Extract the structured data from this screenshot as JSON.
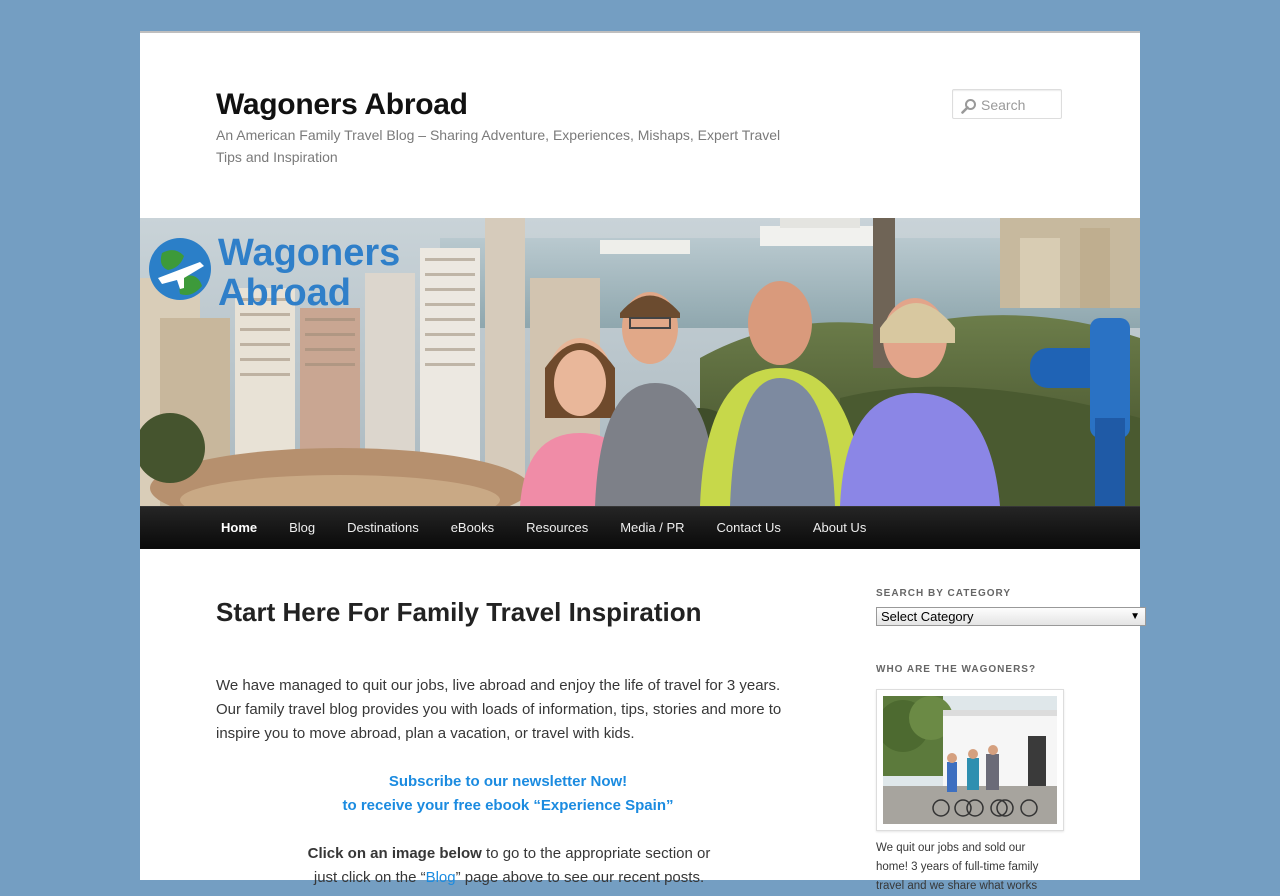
{
  "site": {
    "title": "Wagoners Abroad",
    "description": "An American Family Travel Blog – Sharing Adventure, Experiences, Mishaps, Expert Travel Tips and Inspiration"
  },
  "search": {
    "placeholder": "Search",
    "icon": "search-icon"
  },
  "banner": {
    "logo_line1": "Wagoners",
    "logo_line2": "Abroad",
    "logo_icon": "globe-airplane-icon"
  },
  "nav": {
    "items": [
      {
        "label": "Home",
        "current": true
      },
      {
        "label": "Blog"
      },
      {
        "label": "Destinations"
      },
      {
        "label": "eBooks"
      },
      {
        "label": "Resources"
      },
      {
        "label": "Media / PR"
      },
      {
        "label": "Contact Us"
      },
      {
        "label": "About Us"
      }
    ]
  },
  "main": {
    "title": "Start Here For Family Travel Inspiration",
    "intro": "We have managed to quit our jobs, live abroad and enjoy the life of travel for 3 years.  Our family travel blog provides you with loads of information, tips, stories and more to inspire you to move abroad, plan a vacation, or travel with kids.",
    "subscribe_line1": "Subscribe to our newsletter Now!",
    "subscribe_line2": "to receive your free ebook “Experience Spain”",
    "click_bold": "Click on an image below",
    "click_rest1": " to go to the appropriate section or",
    "click_line2_pre": "just click on the “",
    "click_link": "Blog",
    "click_line2_post": "” page above to see our recent posts."
  },
  "sidebar": {
    "category_title": "SEARCH BY CATEGORY",
    "category_select": "Select Category",
    "who_title": "WHO ARE THE WAGONERS?",
    "who_text": "We quit our jobs and sold our home! 3 years of full-time family travel and we share what works"
  },
  "colors": {
    "background": "#749ec2",
    "link": "#1b8be0",
    "nav": "#1a1a1a"
  }
}
